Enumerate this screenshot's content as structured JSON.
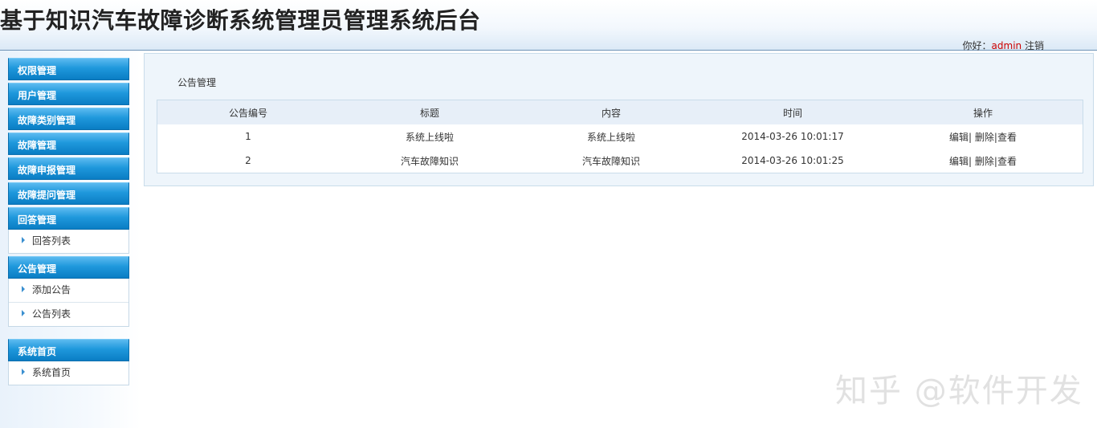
{
  "header": {
    "title": "基于知识汽车故障诊断系统管理员管理系统后台",
    "greeting": "你好：",
    "username": "admin",
    "logout": "注销"
  },
  "sidebar": {
    "sections": [
      {
        "label": "权限管理",
        "items": []
      },
      {
        "label": "用户管理",
        "items": []
      },
      {
        "label": "故障类别管理",
        "items": []
      },
      {
        "label": "故障管理",
        "items": []
      },
      {
        "label": "故障申报管理",
        "items": []
      },
      {
        "label": "故障提问管理",
        "items": []
      },
      {
        "label": "回答管理",
        "items": [
          "回答列表"
        ]
      },
      {
        "label": "公告管理",
        "items": [
          "添加公告",
          "公告列表"
        ]
      },
      {
        "label": "系统首页",
        "items": [
          "系统首页"
        ]
      }
    ]
  },
  "main": {
    "title": "公告管理",
    "columns": [
      "公告编号",
      "标题",
      "内容",
      "时间",
      "操作"
    ],
    "rows": [
      {
        "id": "1",
        "title": "系统上线啦",
        "content": "系统上线啦",
        "time": "2014-03-26 10:01:17"
      },
      {
        "id": "2",
        "title": "汽车故障知识",
        "content": "汽车故障知识",
        "time": "2014-03-26 10:01:25"
      }
    ],
    "actions": {
      "edit": "编辑|",
      "delete": "删除|",
      "view": "查看"
    }
  },
  "watermark": "知乎 @软件开发"
}
